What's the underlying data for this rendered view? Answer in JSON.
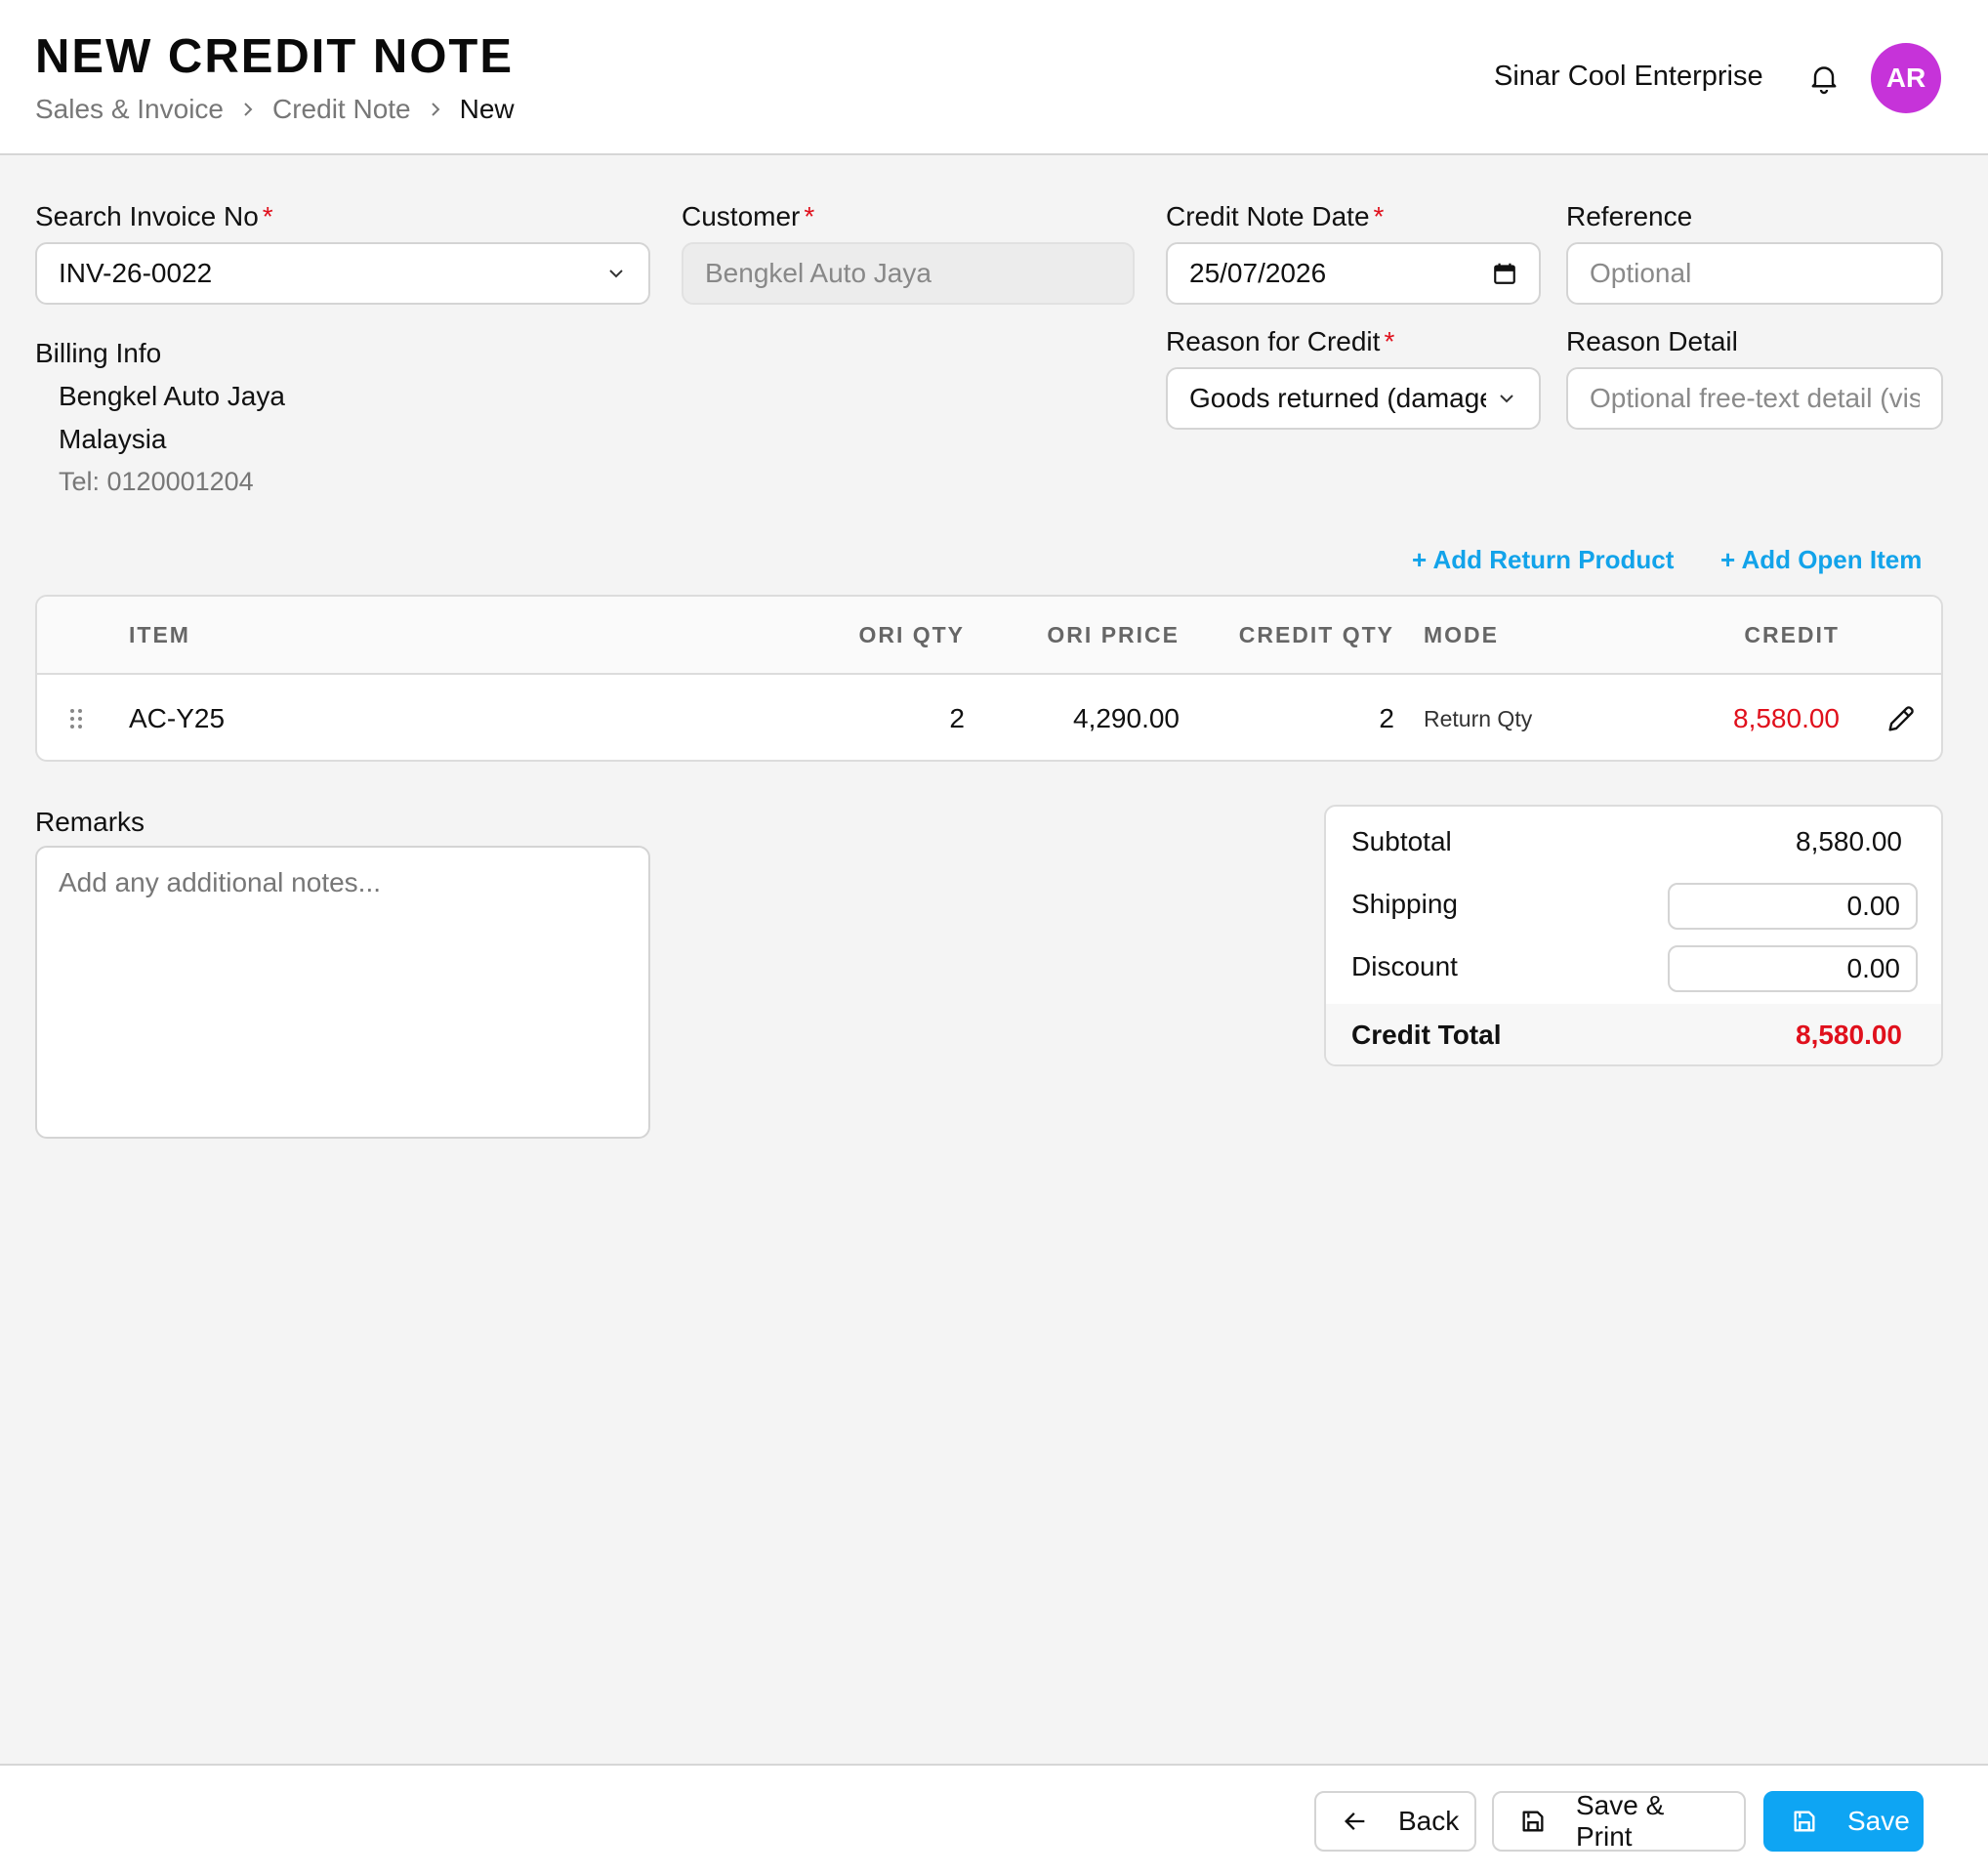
{
  "header": {
    "title": "NEW CREDIT NOTE",
    "breadcrumb": [
      "Sales & Invoice",
      "Credit Note",
      "New"
    ],
    "company": "Sinar Cool Enterprise",
    "avatar_initials": "AR",
    "avatar_color": "#c633d9"
  },
  "form": {
    "invoice": {
      "label": "Search Invoice No",
      "value": "INV-26-0022"
    },
    "customer": {
      "label": "Customer",
      "value": "Bengkel Auto Jaya"
    },
    "date": {
      "label": "Credit Note Date",
      "value": "25/07/2026"
    },
    "reference": {
      "label": "Reference",
      "placeholder": "Optional"
    },
    "reason": {
      "label": "Reason for Credit",
      "value": "Goods returned (damage"
    },
    "reason_detail": {
      "label": "Reason Detail",
      "placeholder": "Optional free-text detail (vis"
    },
    "required_mark": "*"
  },
  "billing": {
    "label": "Billing Info",
    "name": "Bengkel Auto Jaya",
    "country": "Malaysia",
    "tel": "Tel: 0120001204"
  },
  "actions": {
    "add_return_product": "+ Add Return Product",
    "add_open_item": "+ Add Open Item"
  },
  "table": {
    "columns": [
      "ITEM",
      "ORI QTY",
      "ORI PRICE",
      "CREDIT QTY",
      "MODE",
      "CREDIT"
    ],
    "rows": [
      {
        "item": "AC-Y25",
        "ori_qty": "2",
        "ori_price": "4,290.00",
        "credit_qty": "2",
        "mode": "Return Qty",
        "credit": "8,580.00"
      }
    ]
  },
  "remarks": {
    "label": "Remarks",
    "placeholder": "Add any additional notes..."
  },
  "summary": {
    "subtotal_label": "Subtotal",
    "subtotal": "8,580.00",
    "shipping_label": "Shipping",
    "shipping": "0.00",
    "discount_label": "Discount",
    "discount": "0.00",
    "total_label": "Credit Total",
    "total": "8,580.00"
  },
  "footer": {
    "back": "Back",
    "save_print": "Save & Print",
    "save": "Save"
  },
  "colors": {
    "accent": "#0ea5f3",
    "link": "#12a3ea",
    "required": "#e0101c",
    "negative": "#e0101c"
  }
}
